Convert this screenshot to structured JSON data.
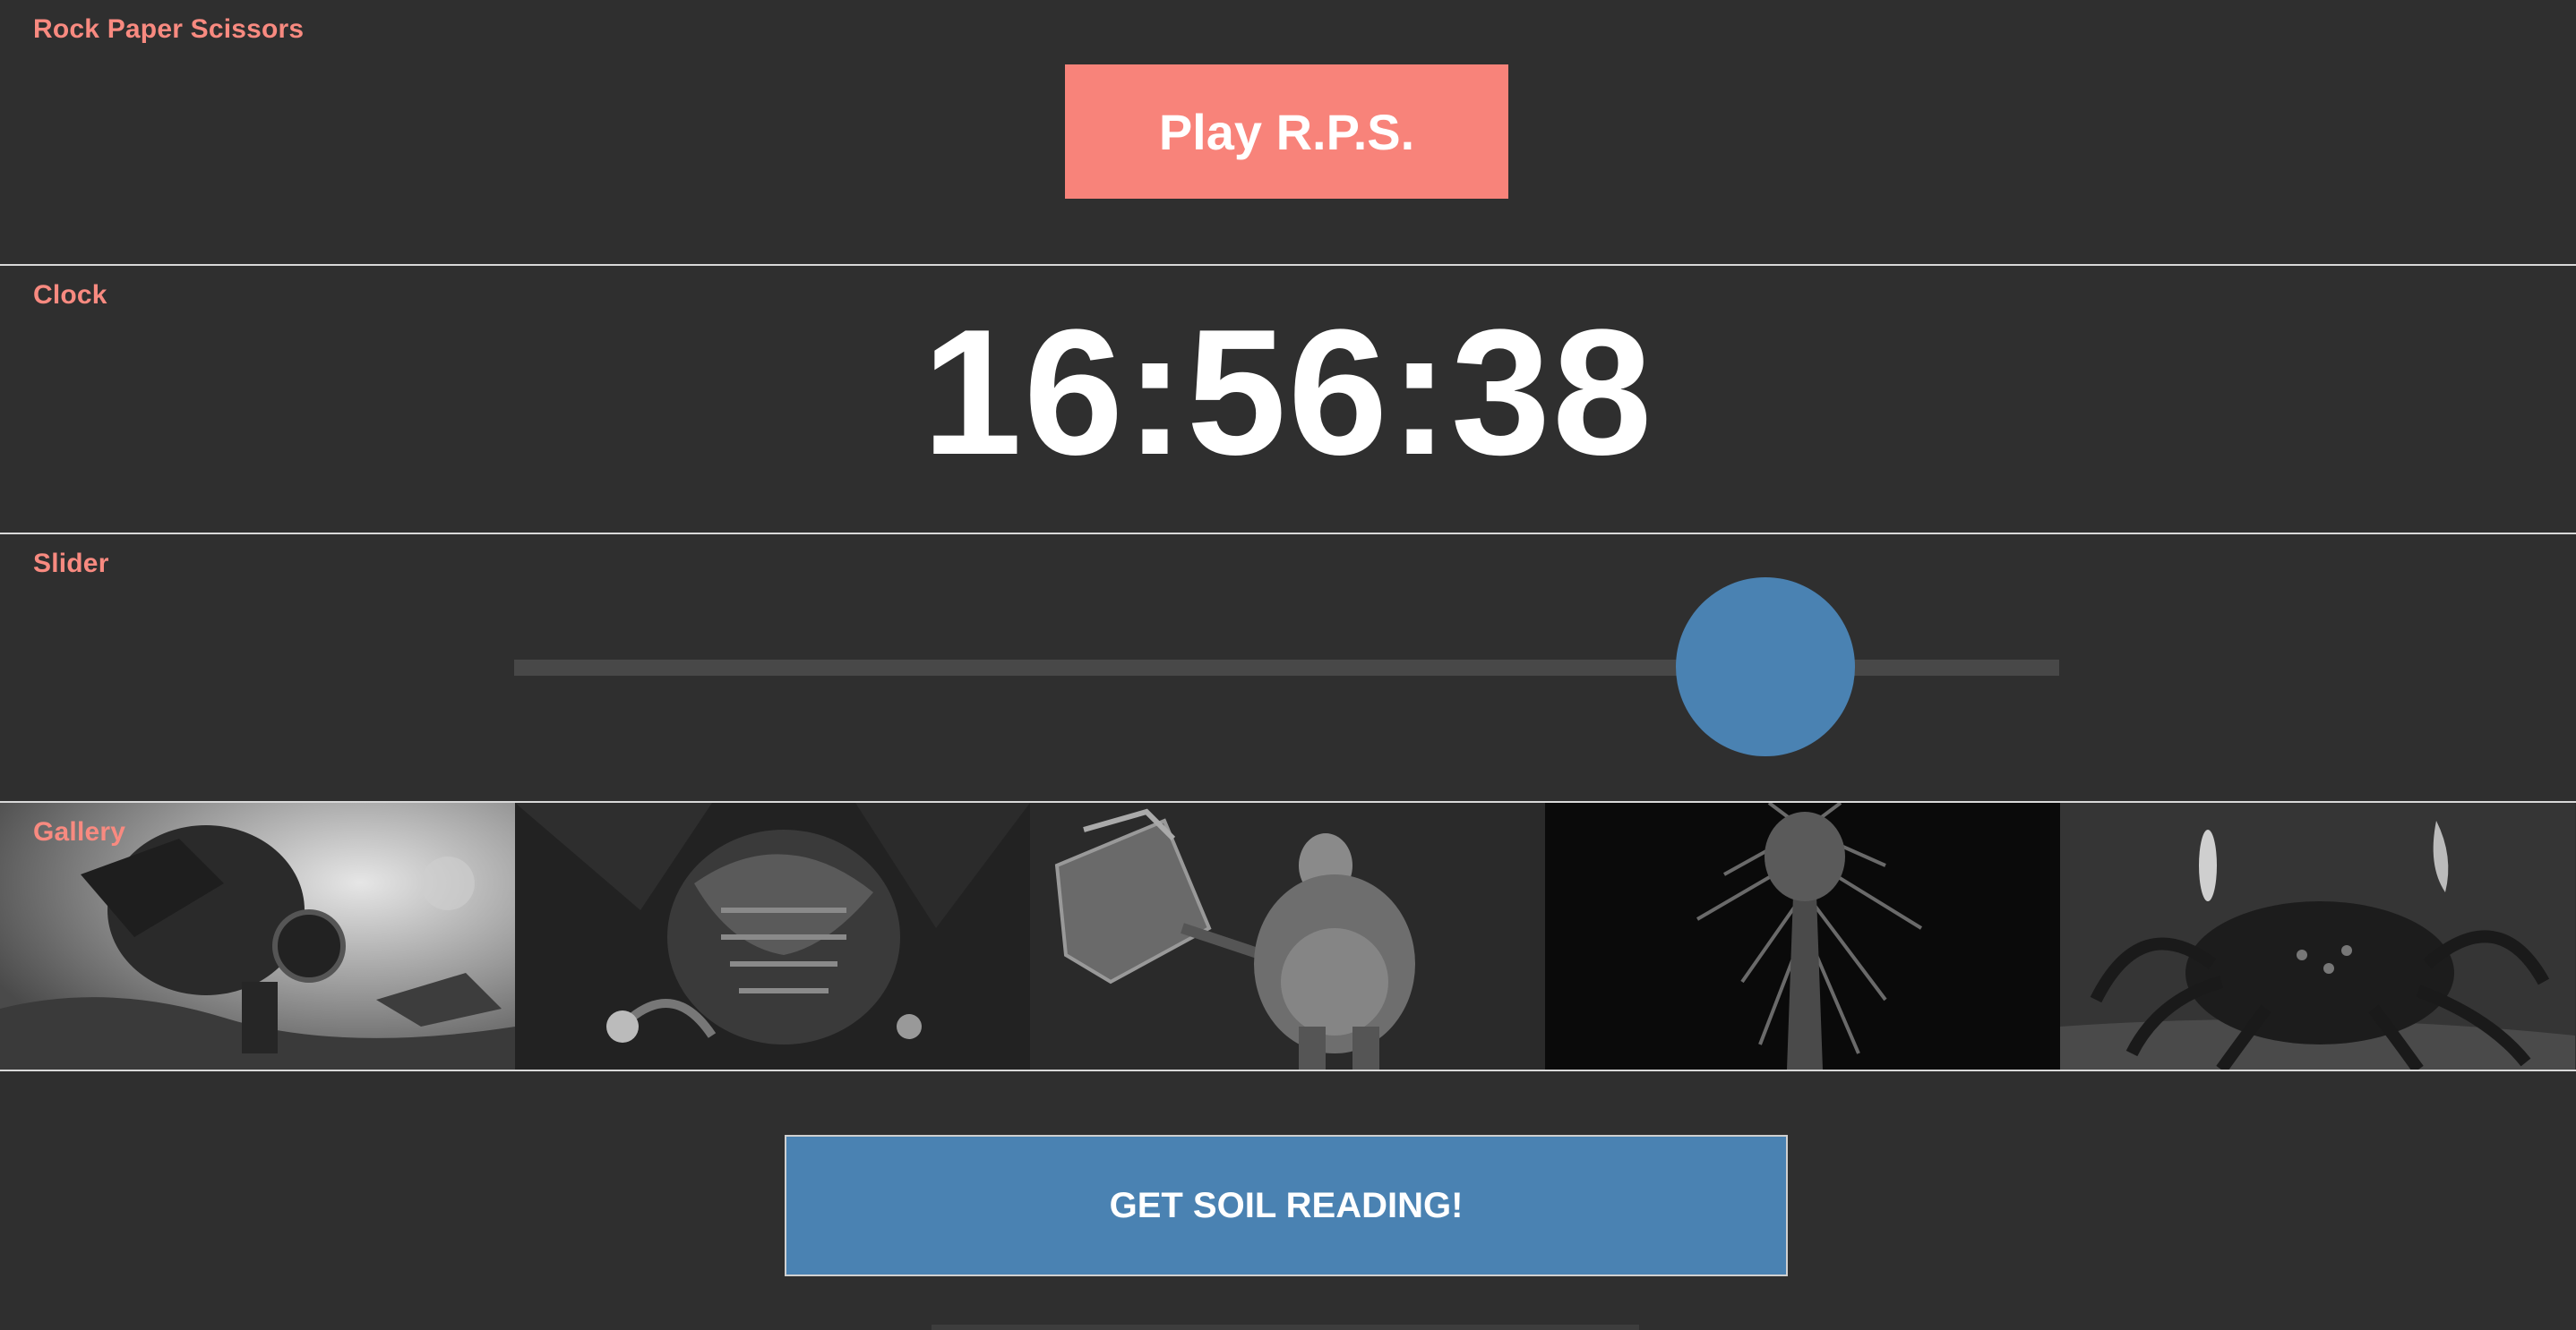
{
  "rps": {
    "label": "Rock Paper Scissors",
    "button_label": "Play R.P.S."
  },
  "clock": {
    "label": "Clock",
    "time": "16:56:38"
  },
  "slider": {
    "label": "Slider",
    "value_fraction": 0.81
  },
  "gallery": {
    "label": "Gallery",
    "images": [
      {
        "name": "golem-battle-image"
      },
      {
        "name": "dragon-image"
      },
      {
        "name": "hammer-warrior-image"
      },
      {
        "name": "dark-tree-creature-image"
      },
      {
        "name": "spider-demon-image"
      }
    ]
  },
  "soil": {
    "button_label": "GET SOIL READING!"
  },
  "colors": {
    "background": "#2f2f2f",
    "accent_salmon": "#f8837a",
    "accent_blue": "#4a82b2",
    "divider": "#d9d9d9"
  }
}
